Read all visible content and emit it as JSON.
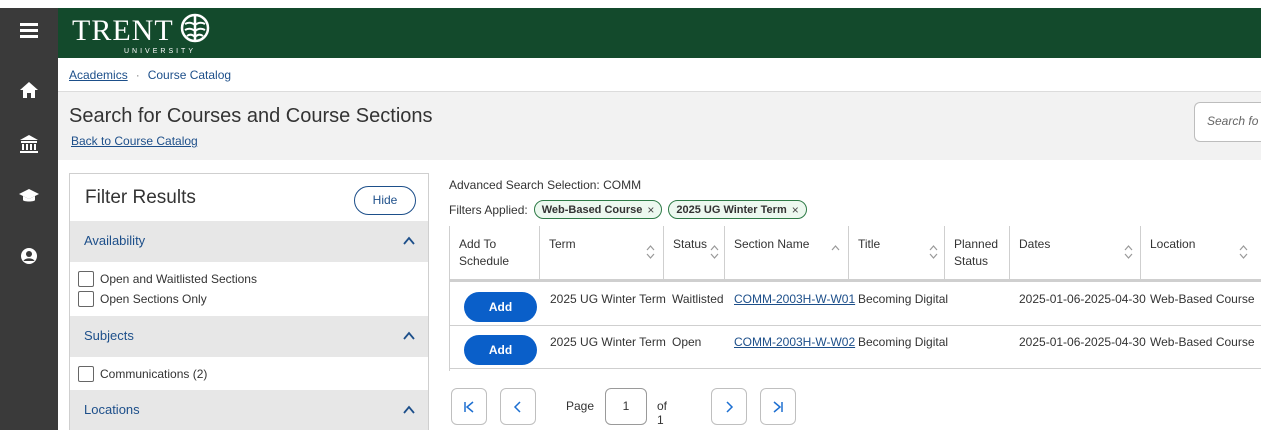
{
  "header": {
    "brand_word": "TRENT",
    "brand_sub": "UNIVERSITY"
  },
  "rail": {
    "icons": [
      "menu-icon",
      "home-icon",
      "institution-icon",
      "graduation-cap-icon",
      "user-circle-icon"
    ]
  },
  "breadcrumb": {
    "root": "Academics",
    "separator": "·",
    "current": "Course Catalog"
  },
  "page": {
    "title": "Search for Courses and Course Sections",
    "back_link": "Back to Course Catalog",
    "search_placeholder": "Search fo"
  },
  "filter": {
    "title": "Filter Results",
    "hide_label": "Hide",
    "sections": [
      {
        "label": "Availability",
        "options": [
          "Open and Waitlisted Sections",
          "Open Sections Only"
        ]
      },
      {
        "label": "Subjects",
        "options": [
          "Communications (2)"
        ]
      },
      {
        "label": "Locations",
        "options": []
      }
    ]
  },
  "results": {
    "advanced_search": "Advanced Search Selection: COMM",
    "filters_label": "Filters Applied:",
    "chips": [
      "Web-Based Course",
      "2025 UG Winter Term"
    ],
    "columns": [
      "Add To Schedule",
      "Term",
      "Status",
      "Section Name",
      "Title",
      "Planned Status",
      "Dates",
      "Location"
    ],
    "rows": [
      {
        "add": "Add",
        "term": "2025 UG Winter Term",
        "status": "Waitlisted",
        "section": "COMM-2003H-W-W01",
        "title": "Becoming Digital",
        "planned": "",
        "dates": "2025-01-06-2025-04-30",
        "location": "Web-Based Course"
      },
      {
        "add": "Add",
        "term": "2025 UG Winter Term",
        "status": "Open",
        "section": "COMM-2003H-W-W02",
        "title": "Becoming Digital",
        "planned": "",
        "dates": "2025-01-06-2025-04-30",
        "location": "Web-Based Course"
      }
    ]
  },
  "pager": {
    "page_label": "Page",
    "current_page": "1",
    "of_label": "of 1"
  },
  "colors": {
    "header_green": "#134a2c",
    "rail_dark": "#3a3a3a",
    "link_blue": "#1d4f8a",
    "button_blue": "#0a5fc9",
    "chip_green": "#2d7a46"
  }
}
